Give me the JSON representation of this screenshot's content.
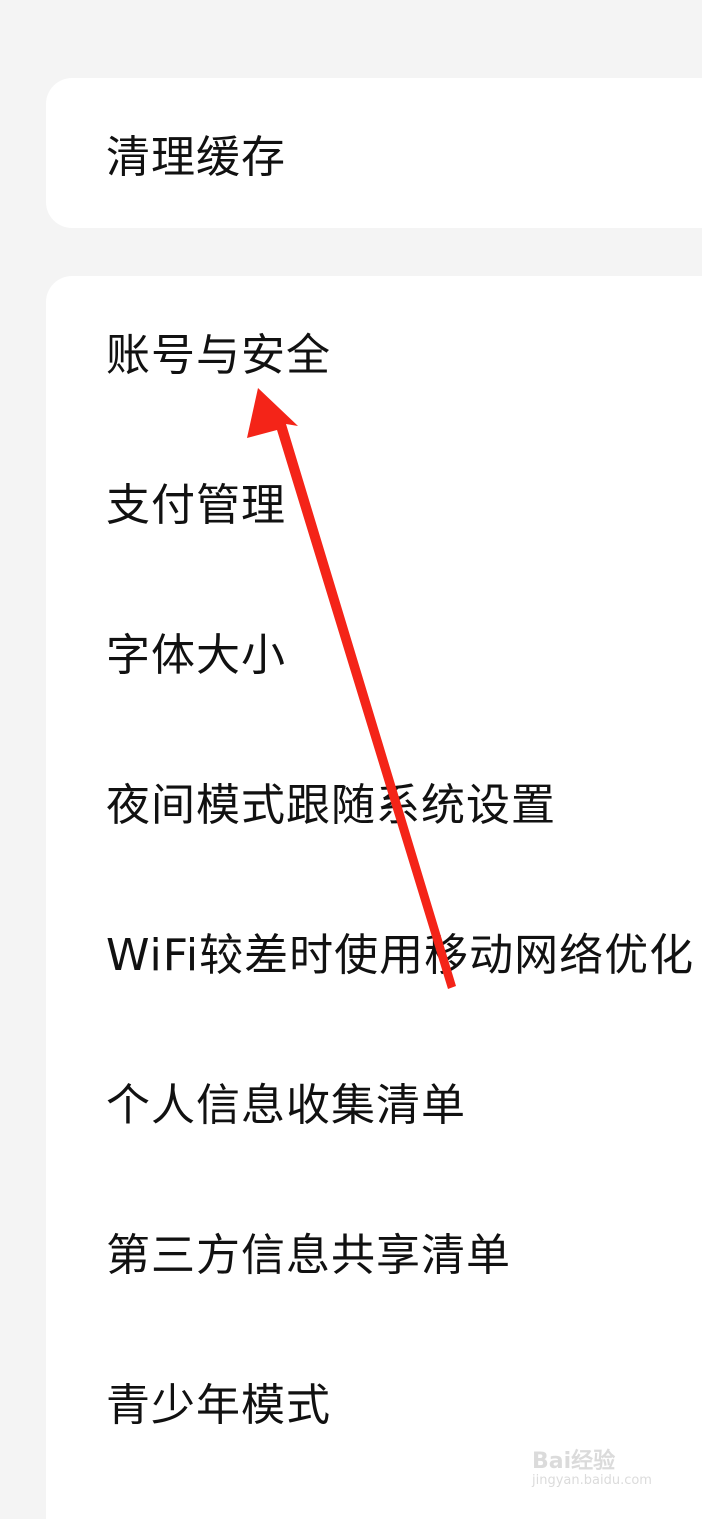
{
  "settings": {
    "group1": {
      "items": [
        {
          "label": "清理缓存"
        }
      ]
    },
    "group2": {
      "items": [
        {
          "label": "账号与安全"
        },
        {
          "label": "支付管理"
        },
        {
          "label": "字体大小"
        },
        {
          "label": "夜间模式跟随系统设置"
        },
        {
          "label": "WiFi较差时使用移动网络优化"
        },
        {
          "label": "个人信息收集清单"
        },
        {
          "label": "第三方信息共享清单"
        },
        {
          "label": "青少年模式"
        }
      ]
    }
  },
  "annotation": {
    "arrow_color": "#f42418",
    "arrow_meaning": "pointing-to-account-security"
  },
  "watermark": {
    "brand": "Bai经验",
    "url": "jingyan.baidu.com"
  }
}
